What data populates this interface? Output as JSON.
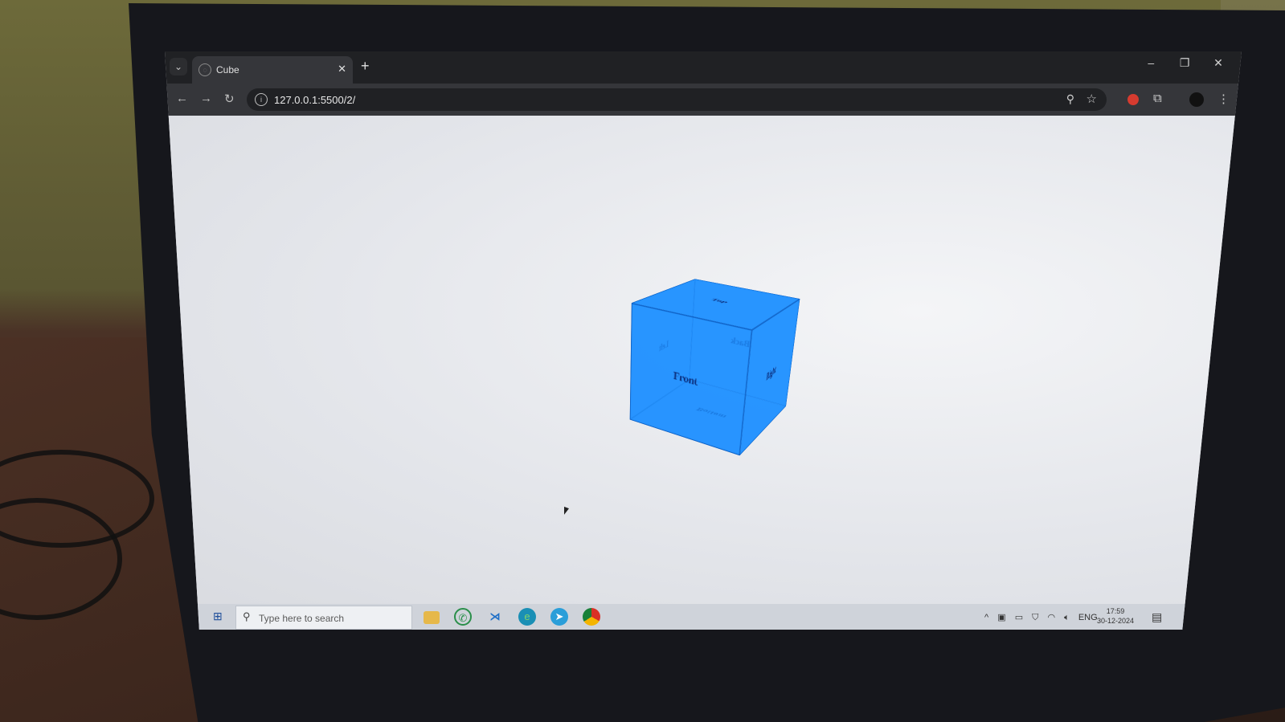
{
  "browser": {
    "tab_title": "Cube",
    "url": "127.0.0.1:5500/2/",
    "new_tab_label": "+",
    "tab_close_label": "✕"
  },
  "cube": {
    "faces": {
      "front": "Front",
      "back": "Back",
      "left": "Left",
      "right": "Right",
      "top": "Top",
      "bottom": "Bottom"
    },
    "color": "#1e90ff"
  },
  "taskbar": {
    "search_placeholder": "Type here to search",
    "language": "ENG",
    "time": "17:59",
    "date": "30-12-2024",
    "apps": [
      "file-explorer",
      "whatsapp",
      "vscode",
      "edge",
      "telegram",
      "chrome"
    ]
  },
  "icons": {
    "back": "←",
    "forward": "→",
    "reload": "↻",
    "zoom": "⚲",
    "star": "☆",
    "menu": "⋮",
    "minimize": "–",
    "maximize": "❐",
    "close": "✕",
    "tab_list": "⌄",
    "windows": "⊞",
    "search": "⚲",
    "notification": "▤"
  }
}
